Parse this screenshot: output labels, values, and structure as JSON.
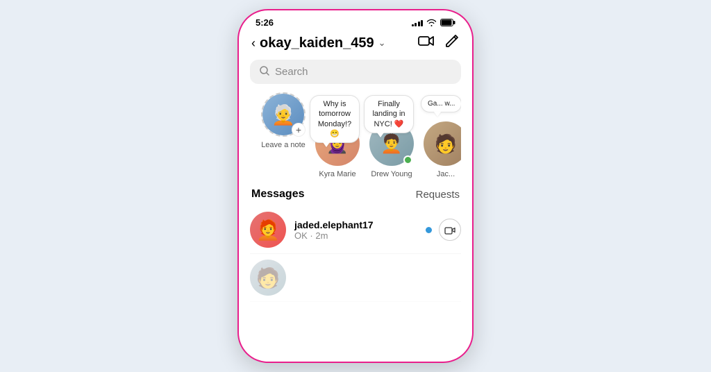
{
  "statusBar": {
    "time": "5:26",
    "signalBars": [
      3,
      5,
      7,
      9,
      11
    ],
    "battery": "full"
  },
  "header": {
    "backLabel": "<",
    "username": "okay_kaiden_459",
    "chevron": "∨",
    "videoIcon": "□",
    "editIcon": "✏"
  },
  "search": {
    "placeholder": "Search"
  },
  "stories": [
    {
      "id": "add-note",
      "label": "Leave a note",
      "hasPlus": true,
      "note": null
    },
    {
      "id": "kyra",
      "label": "Kyra Marie",
      "note": "Why is tomorrow Monday!? 😁",
      "online": false
    },
    {
      "id": "drew",
      "label": "Drew Young",
      "note": "Finally landing in NYC! ❤️",
      "online": true
    },
    {
      "id": "jac",
      "label": "Jac...",
      "note": "Ga... w...",
      "online": false
    }
  ],
  "sections": {
    "messagesLabel": "Messages",
    "requestsLabel": "Requests"
  },
  "messages": [
    {
      "id": "msg1",
      "username": "jaded.elephant17",
      "preview": "OK · 2m",
      "unread": true,
      "hasCamera": true
    },
    {
      "id": "msg2",
      "username": "",
      "preview": "",
      "unread": false,
      "hasCamera": false
    }
  ]
}
